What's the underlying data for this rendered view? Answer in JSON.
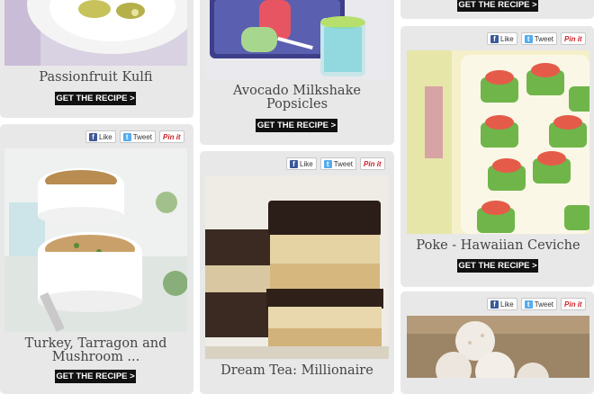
{
  "share": {
    "like": "Like",
    "tweet": "Tweet",
    "pin": "Pin it"
  },
  "cta_label": "GET THE RECIPE >",
  "recipes": [
    {
      "title": "Passionfruit Kulfi"
    },
    {
      "title": "Avocado Milkshake Popsicles"
    },
    {
      "title": ""
    },
    {
      "title": "Turkey, Tarragon and Mushroom ..."
    },
    {
      "title": "Dream Tea: Millionaire"
    },
    {
      "title": "Poke - Hawaiian Ceviche"
    },
    {
      "title": ""
    }
  ],
  "icons": {
    "facebook": "f",
    "twitter": "t"
  }
}
